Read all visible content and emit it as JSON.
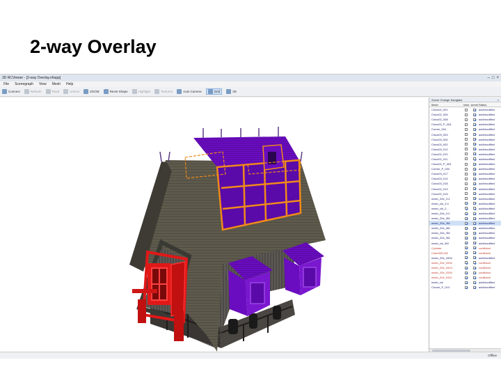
{
  "slide": {
    "title": "2-way Overlay"
  },
  "window": {
    "title": "3D RCViewer - [2-way Overlay.vfrapp]",
    "minimize": "–",
    "maximize": "□",
    "close": "×"
  },
  "menu": [
    "File",
    "Scenegraph",
    "View",
    "Mesh",
    "Help"
  ],
  "toolbar": [
    {
      "label": "Connect",
      "enabled": true
    },
    {
      "label": "Refresh",
      "enabled": false
    },
    {
      "label": "Read",
      "enabled": false
    },
    {
      "label": "Unlock",
      "enabled": false
    },
    {
      "label": "ZOOM",
      "enabled": true
    },
    {
      "label": "Reset Shape",
      "enabled": true
    },
    {
      "label": "Highlight",
      "enabled": false
    },
    {
      "label": "Textures",
      "enabled": false
    },
    {
      "label": "Auto Camera",
      "enabled": true
    },
    {
      "label": "Grid",
      "enabled": true,
      "selected": true
    },
    {
      "label": "3D",
      "enabled": true
    }
  ],
  "panel": {
    "title": "Scene Change Navigator",
    "close": "×",
    "headers": {
      "mesh": "Mesh",
      "c1": "mine",
      "c2": "server",
      "status": "Status"
    },
    "rows": [
      {
        "mesh": "Cinco02_001",
        "c1": false,
        "c2": true,
        "status": "add/modified"
      },
      {
        "mesh": "Cinco02_005",
        "c1": false,
        "c2": true,
        "status": "add/modified"
      },
      {
        "mesh": "Cinco02_008",
        "c1": false,
        "c2": true,
        "status": "add/modified"
      },
      {
        "mesh": "Cinco02_P_004",
        "c1": false,
        "c2": true,
        "status": "add/modified"
      },
      {
        "mesh": "Corner_004",
        "c1": false,
        "c2": true,
        "status": "add/modified"
      },
      {
        "mesh": "Cinco03_003",
        "c1": false,
        "c2": true,
        "status": "add/modified"
      },
      {
        "mesh": "Cinco03_004",
        "c1": false,
        "c2": true,
        "status": "add/modified"
      },
      {
        "mesh": "Cinco03_002",
        "c1": false,
        "c2": true,
        "status": "add/modified"
      },
      {
        "mesh": "Cinco03_012",
        "c1": false,
        "c2": true,
        "status": "add/modified"
      },
      {
        "mesh": "Cinco02_010",
        "c1": false,
        "c2": true,
        "status": "add/modified"
      },
      {
        "mesh": "Cinco02_011",
        "c1": false,
        "c2": true,
        "status": "add/modified"
      },
      {
        "mesh": "Cinco02_P_004",
        "c1": false,
        "c2": true,
        "status": "add/modified"
      },
      {
        "mesh": "Corner_P_004",
        "c1": false,
        "c2": true,
        "status": "add/modified"
      },
      {
        "mesh": "Cinco03_017",
        "c1": false,
        "c2": true,
        "status": "add/modified"
      },
      {
        "mesh": "Cinco03_014",
        "c1": false,
        "c2": true,
        "status": "add/modified"
      },
      {
        "mesh": "Cinco03_018",
        "c1": false,
        "c2": true,
        "status": "add/modified"
      },
      {
        "mesh": "Cinco02_013",
        "c1": false,
        "c2": true,
        "status": "add/modified"
      },
      {
        "mesh": "Cinco02_015",
        "c1": false,
        "c2": true,
        "status": "add/modified"
      },
      {
        "mesh": "mesh_20e_3.4",
        "c1": false,
        "c2": true,
        "status": "add/modified"
      },
      {
        "mesh": "mesh_cls_3.0",
        "c1": true,
        "c2": true,
        "status": "add/modified"
      },
      {
        "mesh": "mesh_cls_2...",
        "c1": true,
        "c2": true,
        "status": "add/modified"
      },
      {
        "mesh": "mesh_20e_3.0",
        "c1": true,
        "c2": true,
        "status": "add/modified"
      },
      {
        "mesh": "mesh_20e_3M",
        "c1": true,
        "c2": true,
        "status": "add/modified"
      },
      {
        "mesh": "mesh_20e_3M",
        "c1": true,
        "c2": true,
        "status": "add/modified",
        "selected": true
      },
      {
        "mesh": "mesh_20e_3M",
        "c1": true,
        "c2": true,
        "status": "add/modified"
      },
      {
        "mesh": "mesh_20e_3M",
        "c1": true,
        "c2": true,
        "status": "add/modified"
      },
      {
        "mesh": "mesh_20e_3M",
        "c1": true,
        "c2": true,
        "status": "add/modified"
      },
      {
        "mesh": "mesh_cls_3M",
        "c1": true,
        "c2": true,
        "status": "add/modified"
      },
      {
        "mesh": "Cylinder",
        "c1": true,
        "c2": true,
        "status": "conflicted",
        "conflict": true
      },
      {
        "mesh": "Cube005.002",
        "c1": true,
        "c2": true,
        "status": "conflicted",
        "conflict": true
      },
      {
        "mesh": "mesh_20e_3334",
        "c1": true,
        "c2": true,
        "status": "add/modified"
      },
      {
        "mesh": "mesh_20e_3332",
        "c1": true,
        "c2": true,
        "status": "conflicted",
        "conflict": true
      },
      {
        "mesh": "mesh_20e_3313",
        "c1": true,
        "c2": true,
        "status": "conflicted",
        "conflict": true
      },
      {
        "mesh": "mesh_20e_3330",
        "c1": true,
        "c2": true,
        "status": "conflicted",
        "conflict": true
      },
      {
        "mesh": "mesh_20e_3311",
        "c1": true,
        "c2": true,
        "status": "conflicted",
        "conflict": true
      },
      {
        "mesh": "mesh_cls",
        "c1": true,
        "c2": true,
        "status": "add/modified"
      },
      {
        "mesh": "Corner_P_013",
        "c1": true,
        "c2": true,
        "status": "add/modified"
      }
    ]
  },
  "status": {
    "right": "Offline"
  },
  "colors": {
    "overlay_mine": "#e01818",
    "overlay_server": "#7a10c8",
    "highlight": "#f08a1a"
  }
}
